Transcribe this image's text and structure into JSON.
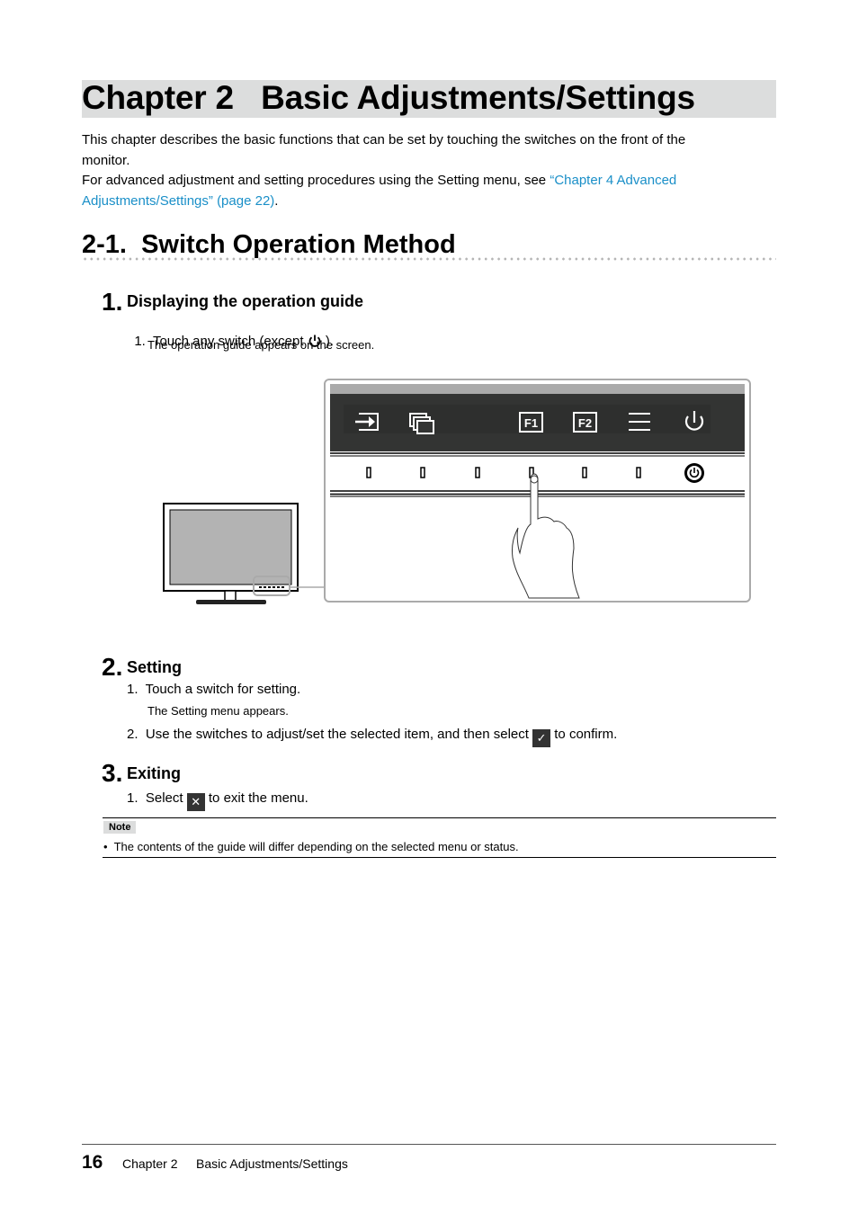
{
  "chapter": {
    "title": "Chapter 2   Basic Adjustments/Settings",
    "intro_line1": "This chapter describes the basic functions that can be set by touching the switches on the front of the",
    "intro_line2": "monitor.",
    "intro_line3_prefix": "For advanced adjustment and setting procedures using the Setting menu, see ",
    "intro_link_part1": "“Chapter 4 Advanced",
    "intro_link_part2": "Adjustments/Settings” (page 22)",
    "intro_line4_suffix": "."
  },
  "section": {
    "title": "2-1.  Switch Operation Method"
  },
  "steps": [
    {
      "number": "1.",
      "title": "Displaying the operation guide",
      "items": [
        {
          "index": "1.",
          "text_before": "Touch any switch (except ",
          "icon": "power-icon",
          "text_after": " ).",
          "sub": "The operation guide appears on the screen."
        }
      ]
    },
    {
      "number": "2.",
      "title": "Setting",
      "items": [
        {
          "index": "1.",
          "text": "Touch a switch for setting.",
          "sub": "The Setting menu appears."
        },
        {
          "index": "2.",
          "text_before": "Use the switches to adjust/set the selected item, and then select ",
          "icon": "check-icon",
          "icon_glyph": "✓",
          "text_after": " to confirm."
        }
      ]
    },
    {
      "number": "3.",
      "title": "Exiting",
      "items": [
        {
          "index": "1.",
          "text_before": "Select ",
          "icon": "close-icon",
          "icon_glyph": "✕",
          "text_after": " to exit the menu."
        }
      ]
    }
  ],
  "illustration": {
    "guide_icons": [
      "input-icon",
      "windows-icon",
      "blank",
      "f1-icon",
      "f2-icon",
      "menu-icon",
      "power-icon"
    ],
    "f1_label": "F1",
    "f2_label": "F2",
    "switch_count": 7
  },
  "note": {
    "label": "Note",
    "bullet": "•",
    "text": "The contents of the guide will differ depending on the selected menu or status."
  },
  "footer": {
    "page_number": "16",
    "chapter": "Chapter 2",
    "title": "Basic Adjustments/Settings"
  },
  "colors": {
    "link": "#1a8fc8",
    "chapter_bar": "#dcdddd",
    "guide_bg": "#333433"
  }
}
